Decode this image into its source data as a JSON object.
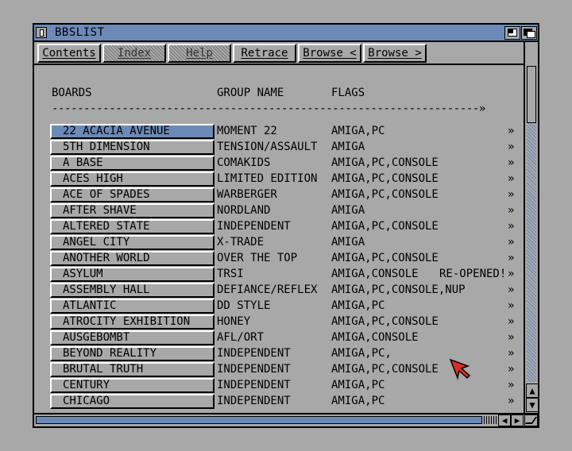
{
  "window": {
    "title": "BBSLIST"
  },
  "toolbar": {
    "buttons": [
      {
        "label": "Contents",
        "enabled": true
      },
      {
        "label": "Index",
        "enabled": false
      },
      {
        "label": "Help",
        "enabled": false
      },
      {
        "label": "Retrace",
        "enabled": true
      },
      {
        "label": "Browse <",
        "enabled": true
      },
      {
        "label": "Browse >",
        "enabled": true
      }
    ]
  },
  "list": {
    "headers": {
      "boards": "BOARDS",
      "group": "GROUP NAME",
      "flags": "FLAGS"
    },
    "divider": "-------------------------------------------------------------------»",
    "rows": [
      {
        "board": "22 ACACIA AVENUE",
        "group": "MOMENT 22",
        "flags": "AMIGA,PC",
        "note": "",
        "arrow": "»",
        "selected": true
      },
      {
        "board": "5TH DIMENSION",
        "group": "TENSION/ASSAULT",
        "flags": "AMIGA",
        "note": "",
        "arrow": "»"
      },
      {
        "board": "A BASE",
        "group": "COMAKIDS",
        "flags": "AMIGA,PC,CONSOLE",
        "note": "",
        "arrow": "»"
      },
      {
        "board": "ACES HIGH",
        "group": "LIMITED EDITION",
        "flags": "AMIGA,PC,CONSOLE",
        "note": "",
        "arrow": "»"
      },
      {
        "board": "ACE OF SPADES",
        "group": "WARBERGER",
        "flags": "AMIGA,PC,CONSOLE",
        "note": "",
        "arrow": "»"
      },
      {
        "board": "AFTER SHAVE",
        "group": "NORDLAND",
        "flags": "AMIGA",
        "note": "",
        "arrow": "»"
      },
      {
        "board": "ALTERED STATE",
        "group": "INDEPENDENT",
        "flags": "AMIGA,PC,CONSOLE",
        "note": "",
        "arrow": "»"
      },
      {
        "board": "ANGEL CITY",
        "group": "X-TRADE",
        "flags": "AMIGA",
        "note": "",
        "arrow": "»"
      },
      {
        "board": "ANOTHER WORLD",
        "group": "OVER THE TOP",
        "flags": "AMIGA,PC,CONSOLE",
        "note": "",
        "arrow": "»"
      },
      {
        "board": "ASYLUM",
        "group": "TRSI",
        "flags": "AMIGA,CONSOLE",
        "note": "RE-OPENED!",
        "arrow": "»"
      },
      {
        "board": "ASSEMBLY HALL",
        "group": "DEFIANCE/REFLEX",
        "flags": "AMIGA,PC,CONSOLE,NUP",
        "note": "",
        "arrow": "»"
      },
      {
        "board": "ATLANTIC",
        "group": "DD STYLE",
        "flags": "AMIGA,PC",
        "note": "",
        "arrow": "»"
      },
      {
        "board": "ATROCITY EXHIBITION",
        "group": "HONEY",
        "flags": "AMIGA,PC,CONSOLE",
        "note": "",
        "arrow": "»"
      },
      {
        "board": "AUSGEBOMBT",
        "group": "AFL/ORT",
        "flags": "AMIGA,CONSOLE",
        "note": "",
        "arrow": "»"
      },
      {
        "board": "BEYOND REALITY",
        "group": "INDEPENDENT",
        "flags": "AMIGA,PC,",
        "note": "",
        "arrow": "»"
      },
      {
        "board": "BRUTAL TRUTH",
        "group": "INDEPENDENT",
        "flags": "AMIGA,PC,CONSOLE",
        "note": "",
        "arrow": "»"
      },
      {
        "board": "CENTURY",
        "group": "INDEPENDENT",
        "flags": "AMIGA,PC",
        "note": "",
        "arrow": "»"
      },
      {
        "board": "CHICAGO",
        "group": "INDEPENDENT",
        "flags": "AMIGA,PC",
        "note": "",
        "arrow": "»"
      }
    ]
  },
  "scrollbar": {
    "up": "▲",
    "down": "▼",
    "left": "◀",
    "right": "▶"
  },
  "colors": {
    "accent": "#6c8ab8",
    "face": "#a8a8a8",
    "pointer": "#d83020"
  }
}
